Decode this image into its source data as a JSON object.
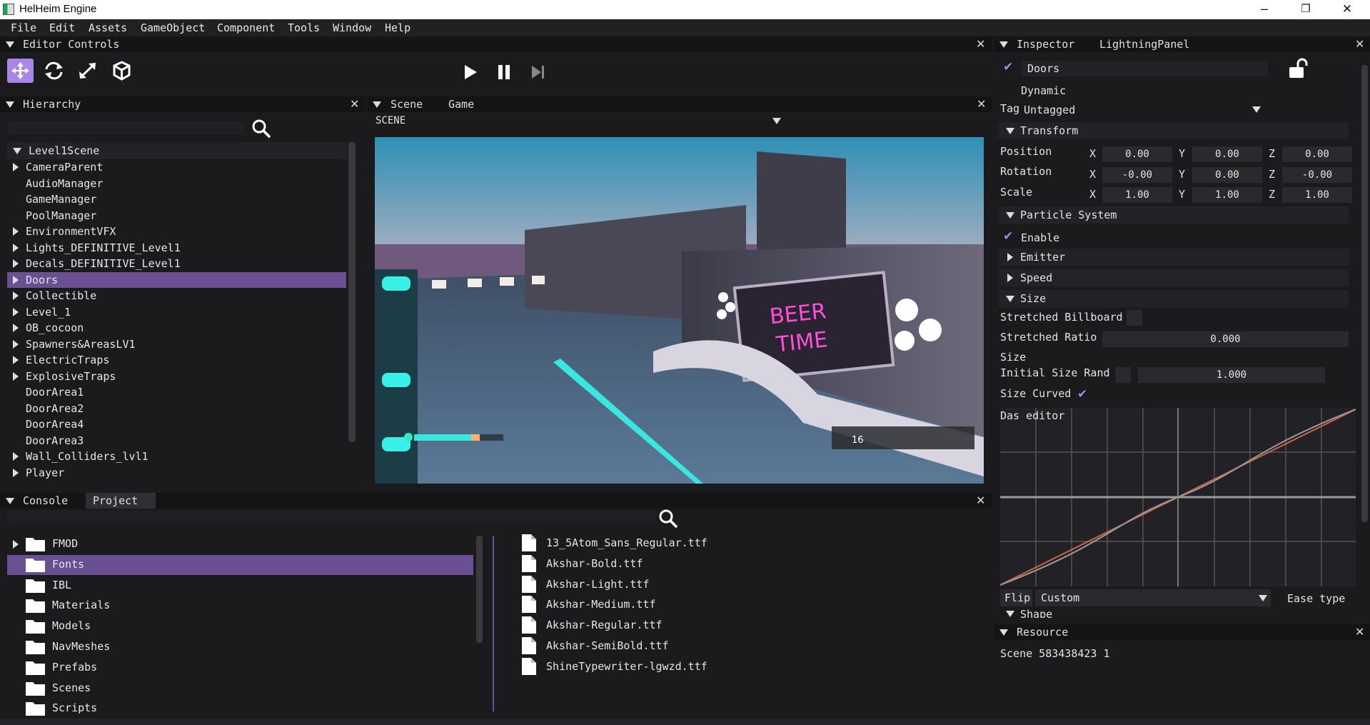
{
  "window": {
    "title": "HelHeim Engine",
    "min": "–",
    "restore": "❐",
    "close": "✕"
  },
  "menu": [
    "File",
    "Edit",
    "Assets",
    "GameObject",
    "Component",
    "Tools",
    "Window",
    "Help"
  ],
  "editor_controls": {
    "title": "Editor Controls"
  },
  "hierarchy": {
    "title": "Hierarchy",
    "root": "Level1Scene",
    "items": [
      {
        "label": "CameraParent",
        "expandable": true
      },
      {
        "label": "AudioManager",
        "expandable": false
      },
      {
        "label": "GameManager",
        "expandable": false
      },
      {
        "label": "PoolManager",
        "expandable": false
      },
      {
        "label": "EnvironmentVFX",
        "expandable": true
      },
      {
        "label": "Lights_DEFINITIVE_Level1",
        "expandable": true
      },
      {
        "label": "Decals_DEFINITIVE_Level1",
        "expandable": true
      },
      {
        "label": "Doors",
        "expandable": true,
        "selected": true
      },
      {
        "label": "Collectible",
        "expandable": true
      },
      {
        "label": "Level_1",
        "expandable": true
      },
      {
        "label": "OB_cocoon",
        "expandable": true
      },
      {
        "label": "Spawners&AreasLV1",
        "expandable": true
      },
      {
        "label": "ElectricTraps",
        "expandable": true
      },
      {
        "label": "ExplosiveTraps",
        "expandable": true
      },
      {
        "label": "DoorArea1",
        "expandable": false
      },
      {
        "label": "DoorArea2",
        "expandable": false
      },
      {
        "label": "DoorArea4",
        "expandable": false
      },
      {
        "label": "DoorArea3",
        "expandable": false
      },
      {
        "label": "Wall_Colliders_lvl1",
        "expandable": true
      },
      {
        "label": "Player",
        "expandable": true
      }
    ]
  },
  "scene": {
    "tabs": [
      "Scene",
      "Game"
    ],
    "dropdown": "SCENE",
    "sign_line1": "BEER",
    "sign_line2": "TIME",
    "hud_ammo": "16"
  },
  "inspector": {
    "tabs": [
      "Inspector",
      "LightningPanel"
    ],
    "object_name": "Doors",
    "dynamic_label": "Dynamic",
    "tag_label": "Tag",
    "tag_value": "Untagged",
    "transform": {
      "title": "Transform",
      "position": {
        "label": "Position",
        "x": "0.00",
        "y": "0.00",
        "z": "0.00"
      },
      "rotation": {
        "label": "Rotation",
        "x": "-0.00",
        "y": "0.00",
        "z": "-0.00"
      },
      "scale": {
        "label": "Scale",
        "x": "1.00",
        "y": "1.00",
        "z": "1.00"
      }
    },
    "axis": {
      "x": "X",
      "y": "Y",
      "z": "Z"
    },
    "particle": {
      "title": "Particle System",
      "enable": "Enable",
      "emitter": "Emitter",
      "speed": "Speed",
      "size": "Size",
      "stretched_billboard": "Stretched Billboard",
      "stretched_ratio_label": "Stretched Ratio",
      "stretched_ratio": "0.000",
      "size_label": "Size",
      "initial_size_rand": "Initial Size Rand",
      "initial_size_value": "1.000",
      "size_curved": "Size Curved",
      "curve_editor": "Das editor",
      "flip": "Flip",
      "ease_value": "Custom",
      "ease_type": "Ease type",
      "shape": "Shape"
    }
  },
  "resource": {
    "title": "Resource",
    "text": "Scene 583438423 1"
  },
  "console": {
    "tabs": [
      "Console",
      "Project"
    ],
    "folders": [
      {
        "label": "FMOD",
        "expandable": true
      },
      {
        "label": "Fonts",
        "expandable": false,
        "selected": true
      },
      {
        "label": "IBL",
        "expandable": false
      },
      {
        "label": "Materials",
        "expandable": false
      },
      {
        "label": "Models",
        "expandable": false
      },
      {
        "label": "NavMeshes",
        "expandable": false
      },
      {
        "label": "Prefabs",
        "expandable": false
      },
      {
        "label": "Scenes",
        "expandable": false
      },
      {
        "label": "Scripts",
        "expandable": false
      }
    ],
    "files": [
      "13_5Atom_Sans_Regular.ttf",
      "Akshar-Bold.ttf",
      "Akshar-Light.ttf",
      "Akshar-Medium.ttf",
      "Akshar-Regular.ttf",
      "Akshar-SemiBold.ttf",
      "ShineTypewriter-lgwzd.ttf"
    ]
  },
  "colors": {
    "accent": "#a987e8",
    "selection": "#6a4f93",
    "panel": "#1b1b1d",
    "header": "#141416",
    "curve_red": "#d0604a",
    "curve_gray": "#9a9a9a"
  }
}
